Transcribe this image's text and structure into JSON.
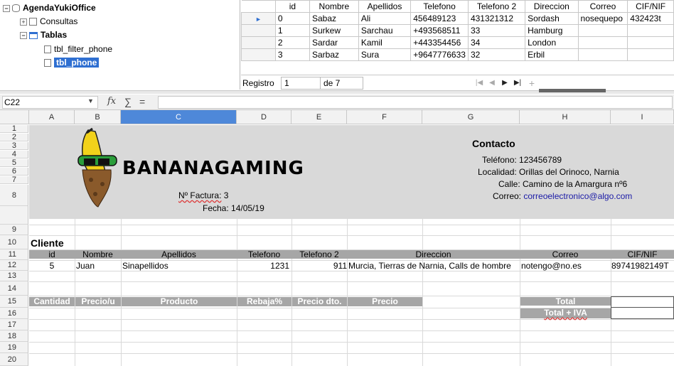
{
  "datasource": {
    "root": "AgendaYukiOffice",
    "queries_label": "Consultas",
    "tables_label": "Tablas",
    "tables": [
      "tbl_filter_phone",
      "tbl_phone"
    ],
    "selected_table": "tbl_phone"
  },
  "grid": {
    "columns": [
      "id",
      "Nombre",
      "Apellidos",
      "Telefono",
      "Telefono 2",
      "Direccion",
      "Correo",
      "CIF/NIF"
    ],
    "rows": [
      [
        "0",
        "Sabaz",
        "Ali",
        "456489123",
        "431321312",
        "Sordash",
        "nosequepo",
        "432423t"
      ],
      [
        "1",
        "Surkew",
        "Sarchau",
        "+493568511",
        "33",
        "Hamburg",
        "",
        ""
      ],
      [
        "2",
        "Sardar",
        "Kamil",
        "+443354456",
        "34",
        "London",
        "",
        ""
      ],
      [
        "3",
        "Sarbaz",
        "Sura",
        "+9647776633",
        "32",
        "Erbil",
        "",
        ""
      ]
    ],
    "record_label": "Registro",
    "record_current": "1",
    "record_of": "de 7"
  },
  "formula_bar": {
    "cell_ref": "C22",
    "fx": "fx",
    "sum": "∑",
    "eq": "="
  },
  "sheet": {
    "columns": [
      "A",
      "B",
      "C",
      "D",
      "E",
      "F",
      "G",
      "H",
      "I"
    ],
    "active_column": "C",
    "rows": [
      "1",
      "2",
      "3",
      "4",
      "5",
      "6",
      "7",
      "8",
      "9",
      "10",
      "11",
      "12",
      "13",
      "14",
      "15",
      "16",
      "17",
      "18",
      "19",
      "20"
    ],
    "logo_text": "BANANAGAMING",
    "invoice_no_label": "Nº Factura:",
    "invoice_no": "3",
    "date_label": "Fecha:",
    "date": "14/05/19",
    "contact_title": "Contacto",
    "phone_line": "Teléfono: 123456789",
    "locality_line": "Localidad: Orillas del Orinoco, Narnia",
    "street_line": "Calle: Camino de la Amargura nº6",
    "email_label": "Correo:",
    "email": "correoelectronico@algo.com",
    "cliente_title": "Cliente",
    "client_headers": [
      "id",
      "Nombre",
      "Apellidos",
      "Telefono",
      "Telefono 2",
      "Direccion",
      "Correo",
      "CIF/NIF"
    ],
    "client_row": [
      "5",
      "Juan",
      "Sinapellidos",
      "1231",
      "911",
      "Murcia, Tierras de Narnia, Calls de hombre",
      "notengo@no.es",
      "89741982149T"
    ],
    "product_headers": [
      "Cantidad",
      "Precio/u",
      "Producto",
      "Rebaja%",
      "Precio dto.",
      "Precio"
    ],
    "total_label": "Total",
    "total_iva_label": "Total + IVA",
    "colors": {
      "band": "#d9d9d9",
      "header_gray": "#a6a6a6",
      "link": "#1a1aa6",
      "active_col": "#4e88d9"
    }
  }
}
